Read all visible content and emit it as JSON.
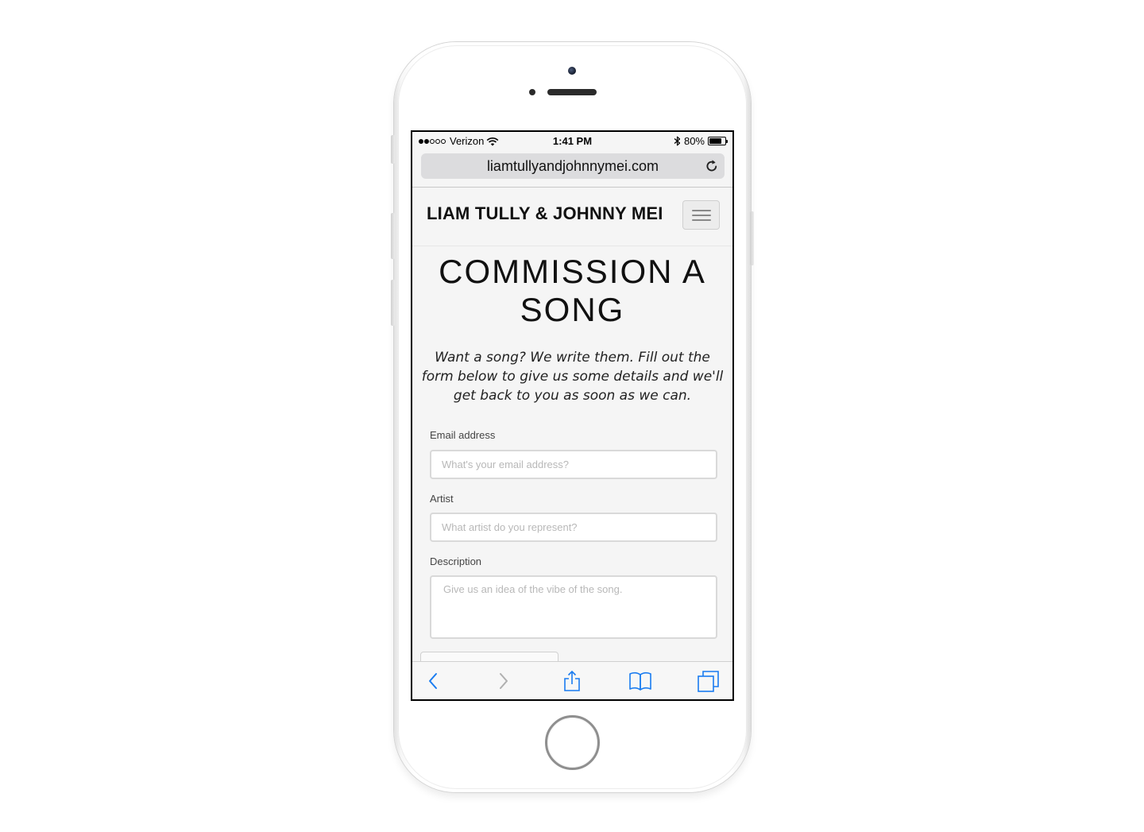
{
  "status_bar": {
    "carrier": "Verizon",
    "time": "1:41 PM",
    "battery": "80%",
    "battery_level": 0.8,
    "signal_bars_filled": 2,
    "signal_bars_total": 5
  },
  "browser": {
    "url": "liamtullyandjohnnymei.com"
  },
  "site": {
    "brand": "LIAM TULLY & JOHNNY MEI",
    "title": "COMMISSION A SONG",
    "intro": "Want a song? We write them. Fill out the form below to give us some details and we'll get back to you as soon as we can."
  },
  "form": {
    "email_label": "Email address",
    "email_placeholder": "What's your email address?",
    "artist_label": "Artist",
    "artist_placeholder": "What artist do you represent?",
    "description_label": "Description",
    "description_placeholder": "Give us an idea of the vibe of the song."
  },
  "toolbar": {
    "icons": [
      "back-icon",
      "forward-icon",
      "share-icon",
      "bookmarks-icon",
      "tabs-icon"
    ]
  },
  "colors": {
    "ios_blue": "#1a7cf0",
    "disabled_gray": "#b0b0b0",
    "page_background": "#f5f5f5"
  }
}
